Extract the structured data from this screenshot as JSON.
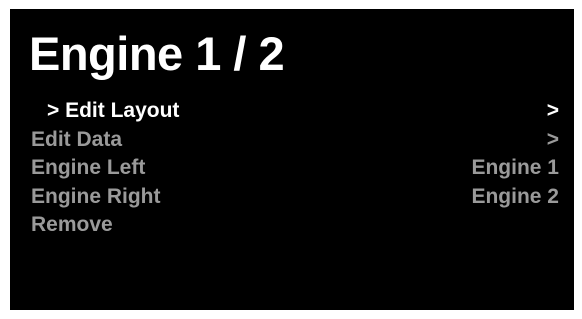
{
  "screen": {
    "title": "Engine 1 / 2",
    "colors": {
      "background": "#000000",
      "text_primary": "#ffffff",
      "text_dim": "#9a9a9a"
    },
    "menu": {
      "items": [
        {
          "label": "> Edit Layout",
          "value": ">",
          "selected": true
        },
        {
          "label": "Edit Data",
          "value": ">",
          "selected": false
        },
        {
          "label": "Engine Left",
          "value": "Engine 1",
          "selected": false
        },
        {
          "label": "Engine Right",
          "value": "Engine 2",
          "selected": false
        },
        {
          "label": "Remove",
          "value": "",
          "selected": false
        }
      ]
    }
  }
}
